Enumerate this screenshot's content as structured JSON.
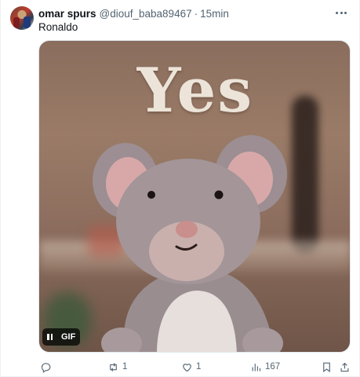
{
  "tweet": {
    "author_name": "omar spurs",
    "author_handle": "@diouf_baba89467",
    "separator": "·",
    "time": "15min",
    "text": "Ronaldo"
  },
  "media": {
    "caption_text": "Yes",
    "gif_label": "GIF",
    "playback_state": "playing"
  },
  "actions": {
    "replies": "",
    "retweets": "1",
    "likes": "1",
    "views": "167"
  },
  "icons": {
    "more": "more-horizontal-icon",
    "reply": "reply-icon",
    "retweet": "retweet-icon",
    "like": "heart-icon",
    "views": "views-chart-icon",
    "bookmark": "bookmark-icon",
    "share": "share-icon",
    "pause": "pause-icon"
  },
  "colors": {
    "text_primary": "#0f1419",
    "text_secondary": "#536471",
    "yes_text": "#ece4d8"
  }
}
